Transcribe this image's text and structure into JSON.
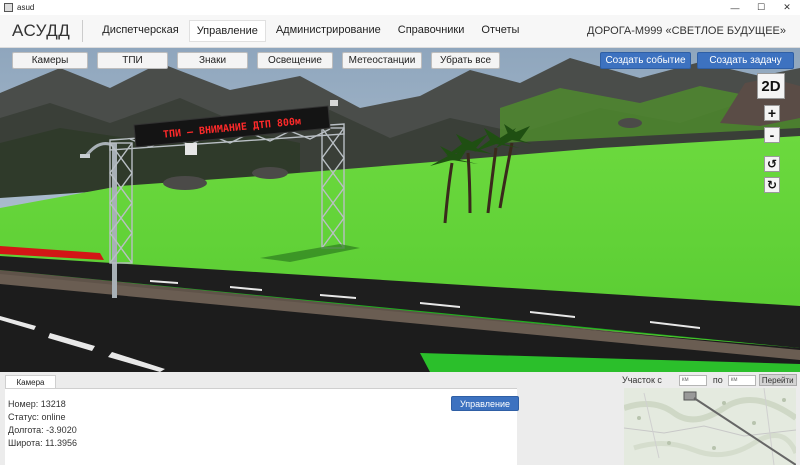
{
  "window": {
    "title": "asud",
    "controls": {
      "minimize": "—",
      "maximize": "☐",
      "close": "✕"
    }
  },
  "header": {
    "brand": "АСУДД",
    "menu": [
      {
        "label": "Диспетчерская",
        "active": false
      },
      {
        "label": "Управление",
        "active": true
      },
      {
        "label": "Администрирование",
        "active": false
      },
      {
        "label": "Справочники",
        "active": false
      },
      {
        "label": "Отчеты",
        "active": false
      }
    ],
    "road": "ДОРОГА-М999  «СВЕТЛОЕ БУДУЩЕЕ»"
  },
  "layers": [
    "Камеры",
    "ТПИ",
    "Знаки",
    "Освещение",
    "Метеостанции",
    "Убрать все"
  ],
  "actions": {
    "create_event": "Создать событие",
    "create_task": "Создать задачу"
  },
  "map_controls": {
    "mode": "2D",
    "zoom_in": "+",
    "zoom_out": "-",
    "rotate_left": "↺",
    "rotate_right": "↻"
  },
  "scene": {
    "sign_text": "ТПИ – ВНИМАНИЕ ДТП 800м"
  },
  "colors": {
    "accent": "#3d72c0",
    "grass": "#5fd63a",
    "sign_text": "#ff2a2a"
  },
  "panel": {
    "tab": "Камера",
    "manage_button": "Управление",
    "lines": [
      "Номер: 13218",
      "Статус: online",
      "Долгота: -3.9020",
      "Широта: 11.3956"
    ]
  },
  "section_form": {
    "from_label": "Участок с",
    "to_label": "по",
    "placeholder": "км",
    "go_button": "Перейти"
  }
}
